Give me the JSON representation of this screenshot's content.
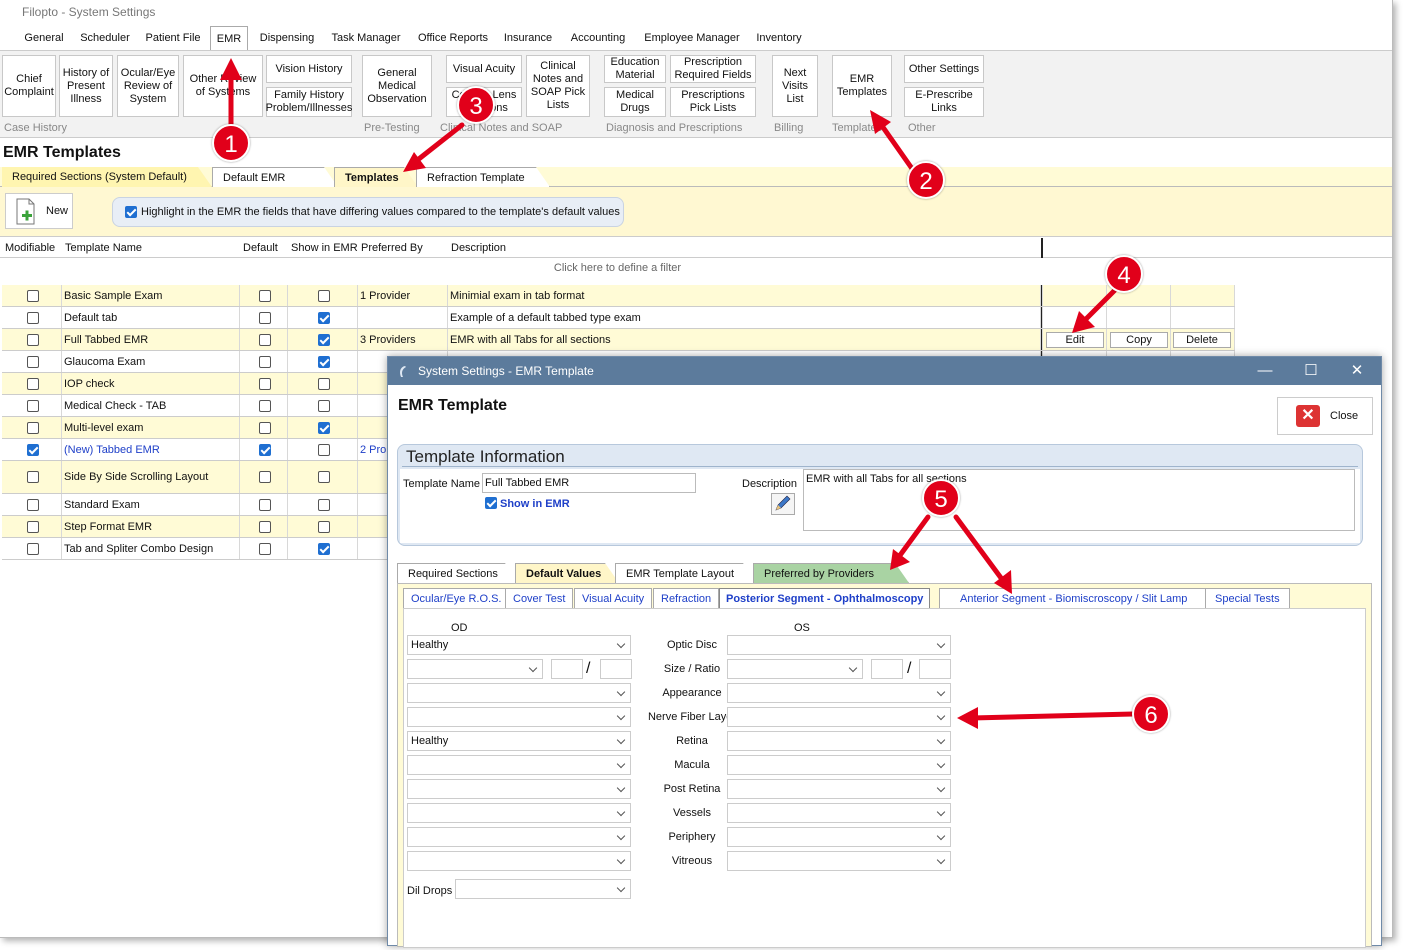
{
  "window": {
    "title": "Filopto - System Settings"
  },
  "menu": [
    "General",
    "Scheduler",
    "Patient File",
    "EMR",
    "Dispensing",
    "Task Manager",
    "Office Reports",
    "Insurance",
    "Accounting",
    "Employee Manager",
    "Inventory"
  ],
  "ribbon": {
    "buttons": {
      "chief": "Chief\nComplaint",
      "history": "History of\nPresent\nIllness",
      "ocular": "Ocular/Eye\nReview of\nSystem",
      "other_review": "Other Review\nof Systems",
      "vision_history": "Vision History",
      "family_history": "Family History\nProblem/Illnesses",
      "general_medical": "General\nMedical\nObservation",
      "visual_acuity": "Visual Acuity",
      "contact_lens": "Contact Lens\nDecisions",
      "clinical_notes": "Clinical\nNotes and\nSOAP Pick\nLists",
      "education": "Education\nMaterial",
      "prescription_fields": "Prescription\nRequired Fields",
      "medical_drugs": "Medical\nDrugs",
      "prescriptions_pick": "Prescriptions\nPick Lists",
      "next_visits": "Next\nVisits\nList",
      "emr_templates": "EMR\nTemplates",
      "other_settings": "Other Settings",
      "eprescribe": "E-Prescribe\nLinks"
    },
    "groups": [
      "Case History",
      "Pre-Testing",
      "Clinical Notes and SOAP",
      "Diagnosis and Prescriptions",
      "Billing",
      "Templates",
      "Other"
    ]
  },
  "page": {
    "title": "EMR Templates",
    "tabs": [
      "Required Sections (System Default)",
      "Default EMR Layout",
      "Templates",
      "Refraction Template"
    ],
    "new_label": "New",
    "highlight_label": "Highlight in the EMR the fields that have differing values compared to the template's default values",
    "filter_text": "Click here to define a filter"
  },
  "grid": {
    "headers": [
      "Modifiable",
      "Template Name",
      "Default",
      "Show in EMR",
      "Preferred By",
      "Description"
    ],
    "rows": [
      {
        "name": "Basic Sample Exam",
        "pref": "1 Provider",
        "desc": "Minimial exam in tab format"
      },
      {
        "name": "Default tab",
        "pref": "",
        "desc": "Example of a default tabbed type exam"
      },
      {
        "name": "Full Tabbed EMR",
        "pref": "3 Providers",
        "desc": "EMR with all Tabs for all sections"
      },
      {
        "name": "Glaucoma Exam",
        "pref": "",
        "desc": ""
      },
      {
        "name": "IOP check",
        "pref": "",
        "desc": ""
      },
      {
        "name": "Medical Check - TAB",
        "pref": "",
        "desc": ""
      },
      {
        "name": "Multi-level exam",
        "pref": "",
        "desc": ""
      },
      {
        "name": "(New) Tabbed EMR",
        "pref": "2 Pro",
        "desc": ""
      },
      {
        "name": "Side By Side Scrolling Layout",
        "pref": "",
        "desc": ""
      },
      {
        "name": "Standard Exam",
        "pref": "",
        "desc": ""
      },
      {
        "name": "Step Format EMR",
        "pref": "",
        "desc": ""
      },
      {
        "name": "Tab and Spliter Combo Design",
        "pref": "",
        "desc": ""
      }
    ],
    "actions": [
      "Edit",
      "Copy",
      "Delete"
    ]
  },
  "dialog": {
    "title": "System Settings - EMR Template",
    "heading": "EMR Template",
    "close_label": "Close",
    "section_title": "Template Information",
    "template_name_label": "Template Name",
    "template_name_value": "Full Tabbed EMR",
    "show_in_emr_label": "Show in EMR",
    "description_label": "Description",
    "description_value": "EMR with all Tabs for all sections",
    "tabs": [
      "Required Sections",
      "Default Values",
      "EMR Template Layout",
      "Preferred by Providers"
    ],
    "subtabs": [
      "Ocular/Eye R.O.S.",
      "Cover Test",
      "Visual Acuity",
      "Refraction",
      "Posterior Segment - Ophthalmoscopy",
      "Anterior Segment - Biomiscroscopy / Slit Lamp",
      "Special Tests"
    ],
    "od_label": "OD",
    "os_label": "OS",
    "fields": [
      "Optic Disc",
      "Size / Ratio",
      "Appearance",
      "Nerve Fiber Layer",
      "Retina",
      "Macula",
      "Post Retina",
      "Vessels",
      "Periphery",
      "Vitreous"
    ],
    "od_values": [
      "Healthy",
      "",
      "",
      "",
      "Healthy",
      "",
      "",
      "",
      "",
      ""
    ],
    "dil_drops_label": "Dil Drops",
    "slash": "/"
  },
  "callouts": [
    "1",
    "2",
    "3",
    "4",
    "5",
    "6"
  ],
  "colors": {
    "accent": "#e1001a",
    "dialog_title": "#5c7b9c",
    "row_alt": "#fffbd6",
    "link_blue": "#1e3fc8"
  }
}
